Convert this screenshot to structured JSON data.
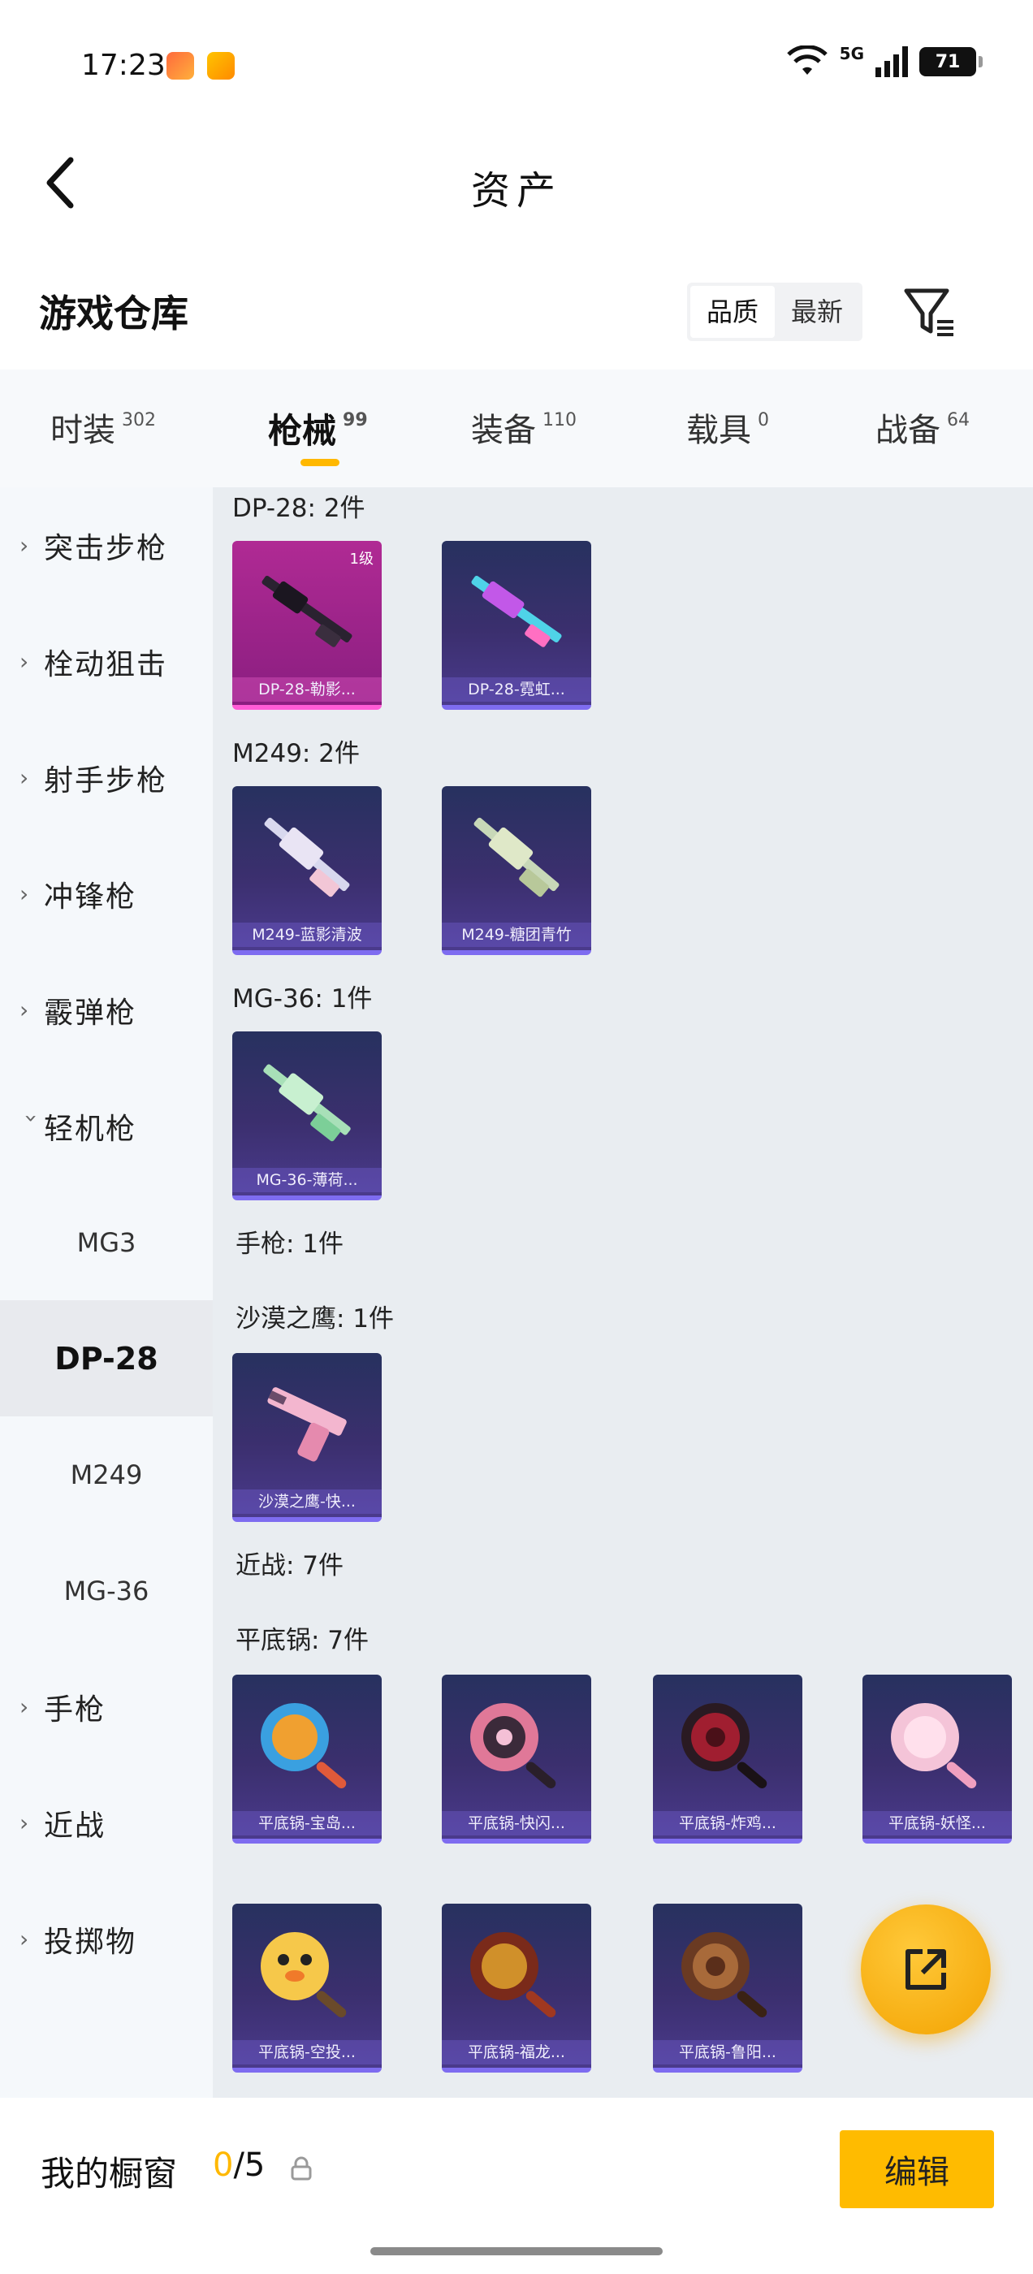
{
  "status": {
    "time": "17:23",
    "network": "5G",
    "battery": "71"
  },
  "header": {
    "title": "资产",
    "back_icon": "chevron-left-icon"
  },
  "warehouse": {
    "title": "游戏仓库",
    "sort_options": [
      "品质",
      "最新"
    ],
    "sort_selected": "品质",
    "filter_icon": "filter-icon"
  },
  "tabs": [
    {
      "label": "时装",
      "count": "302"
    },
    {
      "label": "枪械",
      "count": "99"
    },
    {
      "label": "装备",
      "count": "110"
    },
    {
      "label": "载具",
      "count": "0"
    },
    {
      "label": "战备",
      "count": "64"
    }
  ],
  "active_tab": "枪械",
  "sidebar": {
    "categories": [
      "突击步枪",
      "栓动狙击",
      "射手步枪",
      "冲锋枪",
      "霰弹枪",
      "轻机枪"
    ],
    "sub_items": [
      "MG3",
      "DP-28",
      "M249",
      "MG-36"
    ],
    "active_sub": "DP-28",
    "tail_categories": [
      "手枪",
      "近战",
      "投掷物"
    ]
  },
  "groups": {
    "dp28": {
      "label": "DP-28: 2件",
      "items": [
        {
          "name": "DP-28-勒影...",
          "level": "1级"
        },
        {
          "name": "DP-28-霓虹..."
        }
      ]
    },
    "m249": {
      "label": "M249: 2件",
      "items": [
        {
          "name": "M249-蓝影清波"
        },
        {
          "name": "M249-糖团青竹"
        }
      ]
    },
    "mg36": {
      "label": "MG-36: 1件",
      "items": [
        {
          "name": "MG-36-薄荷..."
        }
      ]
    },
    "pistol_header": {
      "label": "手枪: 1件"
    },
    "deagle": {
      "label": "沙漠之鹰: 1件",
      "items": [
        {
          "name": "沙漠之鹰-快..."
        }
      ]
    },
    "melee_header": {
      "label": "近战: 7件"
    },
    "pan": {
      "label": "平底锅: 7件",
      "items": [
        {
          "name": "平底锅-宝岛..."
        },
        {
          "name": "平底锅-快闪..."
        },
        {
          "name": "平底锅-炸鸡..."
        },
        {
          "name": "平底锅-妖怪..."
        },
        {
          "name": "平底锅-空投..."
        },
        {
          "name": "平底锅-福龙..."
        },
        {
          "name": "平底锅-鲁阳..."
        }
      ]
    }
  },
  "fab_icon": "share-icon",
  "bottom": {
    "label": "我的橱窗",
    "current": "0",
    "total": "/5",
    "lock_icon": "lock-icon",
    "edit_label": "编辑"
  }
}
